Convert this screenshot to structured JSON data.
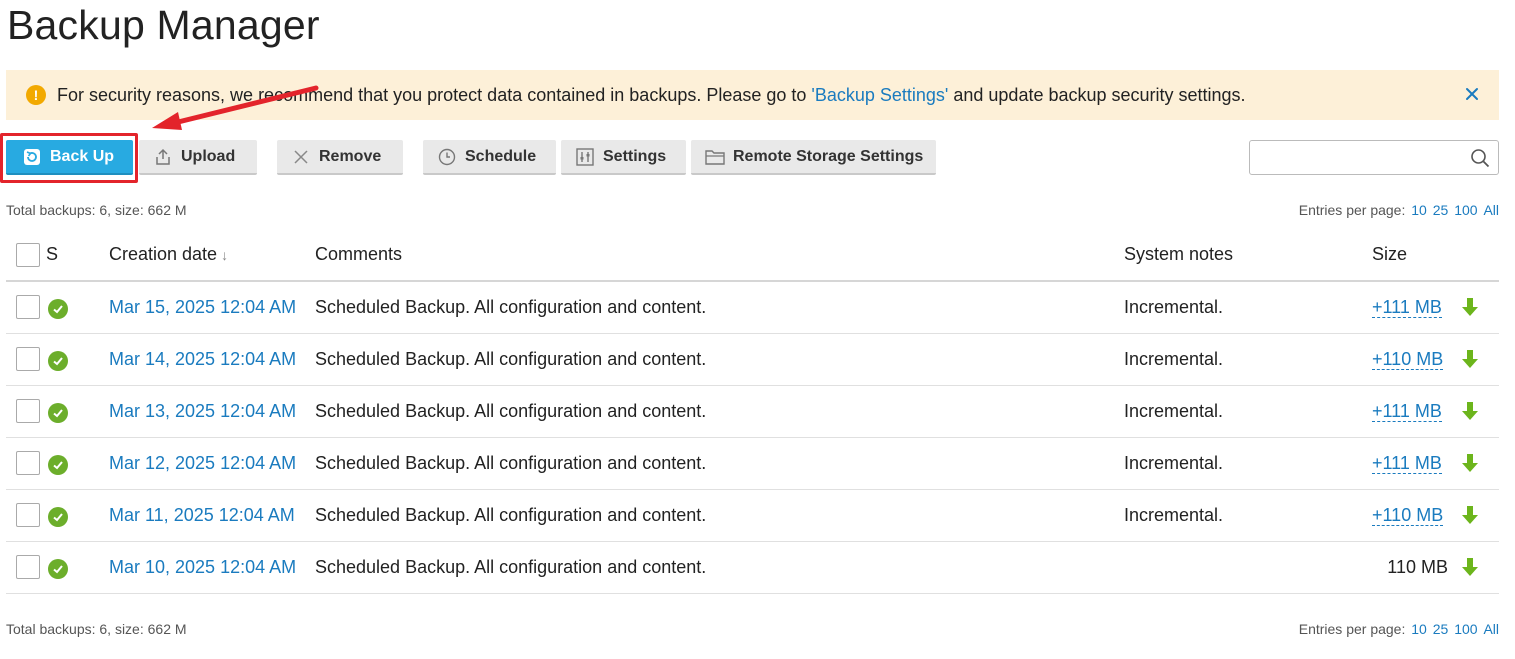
{
  "page": {
    "title": "Backup Manager"
  },
  "alert": {
    "text_before": "For security reasons, we recommend that you protect data contained in backups. Please go to ",
    "link": "'Backup Settings'",
    "text_after": " and update backup security settings."
  },
  "toolbar": {
    "backup_label": "Back Up",
    "upload_label": "Upload",
    "remove_label": "Remove",
    "schedule_label": "Schedule",
    "settings_label": "Settings",
    "remote_label": "Remote Storage Settings"
  },
  "search": {
    "placeholder": ""
  },
  "summary": {
    "text": "Total backups: 6, size: 662 M"
  },
  "pagination": {
    "label": "Entries per page:",
    "options": [
      "10",
      "25",
      "100",
      "All"
    ]
  },
  "table": {
    "headers": {
      "status": "S",
      "date": "Creation date",
      "sort_indicator": "↓",
      "comments": "Comments",
      "notes": "System notes",
      "size": "Size"
    },
    "rows": [
      {
        "date": "Mar 15, 2025 12:04 AM",
        "comment": "Scheduled Backup. All configuration and content.",
        "notes": "Incremental.",
        "size": "+111 MB",
        "size_linked": true
      },
      {
        "date": "Mar 14, 2025 12:04 AM",
        "comment": "Scheduled Backup. All configuration and content.",
        "notes": "Incremental.",
        "size": "+110 MB",
        "size_linked": true
      },
      {
        "date": "Mar 13, 2025 12:04 AM",
        "comment": "Scheduled Backup. All configuration and content.",
        "notes": "Incremental.",
        "size": "+111 MB",
        "size_linked": true
      },
      {
        "date": "Mar 12, 2025 12:04 AM",
        "comment": "Scheduled Backup. All configuration and content.",
        "notes": "Incremental.",
        "size": "+111 MB",
        "size_linked": true
      },
      {
        "date": "Mar 11, 2025 12:04 AM",
        "comment": "Scheduled Backup. All configuration and content.",
        "notes": "Incremental.",
        "size": "+110 MB",
        "size_linked": true
      },
      {
        "date": "Mar 10, 2025 12:04 AM",
        "comment": "Scheduled Backup. All configuration and content.",
        "notes": "",
        "size": "110 MB",
        "size_linked": false
      }
    ]
  },
  "colors": {
    "accent": "#28aae1",
    "link": "#1a7bbf",
    "alert_bg": "#fdf0d8",
    "success": "#6cae2b",
    "highlight": "#e3242b"
  },
  "icons": [
    "warning-icon",
    "close-icon",
    "backup-icon",
    "upload-icon",
    "remove-icon",
    "clock-icon",
    "settings-icon",
    "folder-icon",
    "search-icon",
    "checkmark-icon",
    "download-icon",
    "annotation-arrow"
  ]
}
